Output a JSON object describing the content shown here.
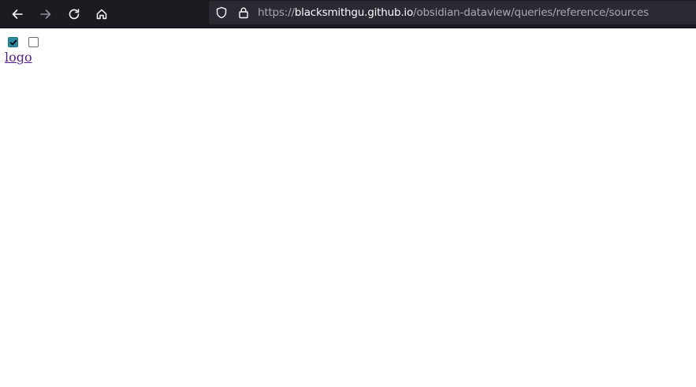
{
  "browser": {
    "nav": {
      "back_icon": "arrow-left-icon",
      "forward_icon": "arrow-right-icon",
      "reload_icon": "reload-icon",
      "home_icon": "home-icon"
    },
    "urlbar": {
      "scheme": "https://",
      "host": "blacksmithgu.github.io",
      "path": "/obsidian-dataview/queries/reference/sources"
    }
  },
  "page": {
    "checkboxes": [
      {
        "checked": true
      },
      {
        "checked": false
      }
    ],
    "logo_link_text": "logo"
  },
  "colors": {
    "toolbar_bg": "#1c1b22",
    "urlbar_bg": "#2b2a33",
    "checkbox_accent": "#2a8ca0",
    "visited_link": "#551a8b"
  }
}
